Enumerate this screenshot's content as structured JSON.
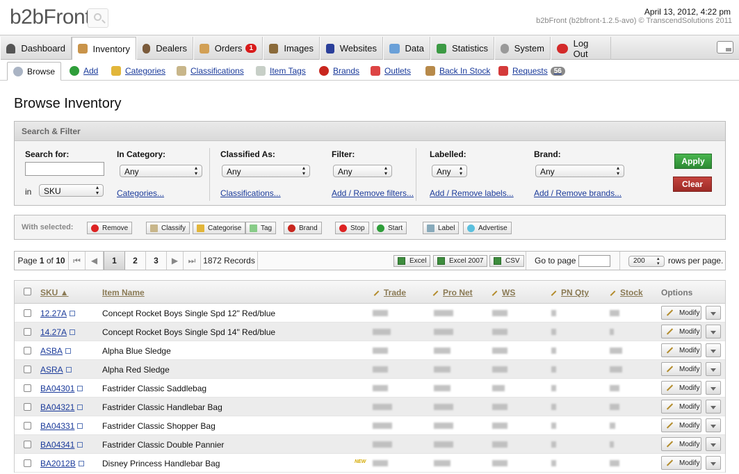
{
  "header": {
    "logo": "b2bFront",
    "datetime": "April 13, 2012, 4:22 pm",
    "version": "b2bFront (b2bfront-1.2.5-avo) © TranscendSolutions 2011"
  },
  "mainnav": {
    "tabs": [
      {
        "label": "Dashboard"
      },
      {
        "label": "Inventory"
      },
      {
        "label": "Dealers"
      },
      {
        "label": "Orders",
        "badge": "1"
      },
      {
        "label": "Images"
      },
      {
        "label": "Websites"
      },
      {
        "label": "Data"
      },
      {
        "label": "Statistics"
      },
      {
        "label": "System"
      },
      {
        "label": "Log Out"
      }
    ]
  },
  "subnav": {
    "tabs": [
      {
        "label": "Browse"
      },
      {
        "label": "Add"
      },
      {
        "label": "Categories"
      },
      {
        "label": "Classifications"
      },
      {
        "label": "Item Tags"
      },
      {
        "label": "Brands"
      },
      {
        "label": "Outlets"
      },
      {
        "label": "Back In Stock"
      },
      {
        "label": "Requests",
        "badge": "56"
      }
    ]
  },
  "page_title": "Browse Inventory",
  "filter": {
    "heading": "Search & Filter",
    "search_label": "Search for:",
    "search_value": "",
    "in_label": "in",
    "in_value": "SKU",
    "category_label": "In Category:",
    "category_value": "Any",
    "category_link": "Categories...",
    "classified_label": "Classified As:",
    "classified_value": "Any",
    "classified_link": "Classifications...",
    "filter_label": "Filter:",
    "filter_value": "Any",
    "filter_link": "Add / Remove filters...",
    "labelled_label": "Labelled:",
    "labelled_value": "Any",
    "labelled_link": "Add / Remove labels...",
    "brand_label": "Brand:",
    "brand_value": "Any",
    "brand_link": "Add / Remove brands...",
    "apply": "Apply",
    "clear": "Clear"
  },
  "with_selected": {
    "label": "With selected:",
    "buttons": [
      "Remove",
      "Classify",
      "Categorise",
      "Tag",
      "Brand",
      "Stop",
      "Start",
      "Label",
      "Advertise"
    ]
  },
  "pager": {
    "page_prefix": "Page",
    "page_current": "1",
    "page_of": "of",
    "page_total": "10",
    "pages": [
      "1",
      "2",
      "3"
    ],
    "records": "1872 Records",
    "exports": [
      "Excel",
      "Excel 2007",
      "CSV"
    ],
    "goto_label": "Go to page",
    "goto_value": "",
    "rows_value": "200",
    "rows_label": "rows per page."
  },
  "table": {
    "headers": {
      "sku": "SKU ▲",
      "item_name": "Item Name",
      "trade": "Trade",
      "pro_net": "Pro Net",
      "ws": "WS",
      "pn_qty": "PN Qty",
      "stock": "Stock",
      "options": "Options"
    },
    "modify_label": "Modify",
    "new_tag": "NEW",
    "rows": [
      {
        "sku": "12.27A",
        "name": "Concept Rocket Boys Single Spd 12\" Red/blue"
      },
      {
        "sku": "14.27A",
        "name": "Concept Rocket Boys Single Spd 14\" Red/blue"
      },
      {
        "sku": "ASBA",
        "name": "Alpha Blue Sledge"
      },
      {
        "sku": "ASRA",
        "name": "Alpha Red Sledge"
      },
      {
        "sku": "BA04301",
        "name": "Fastrider Classic Saddlebag"
      },
      {
        "sku": "BA04321",
        "name": "Fastrider Classic Handlebar Bag"
      },
      {
        "sku": "BA04331",
        "name": "Fastrider Classic Shopper Bag"
      },
      {
        "sku": "BA04341",
        "name": "Fastrider Classic Double Pannier"
      },
      {
        "sku": "BA2012B",
        "name": "Disney Princess Handlebar Bag",
        "is_new": true
      }
    ]
  }
}
